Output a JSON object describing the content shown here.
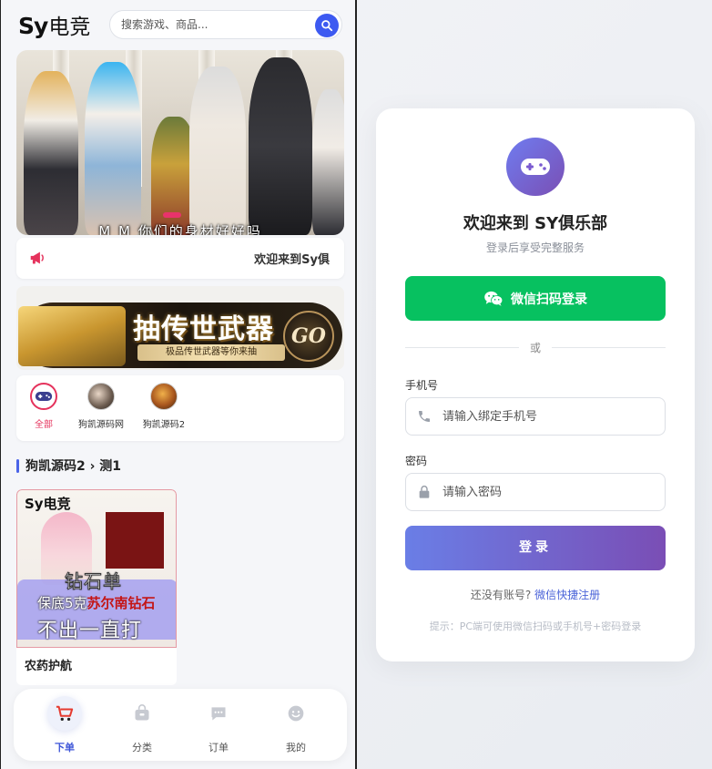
{
  "colors": {
    "accent_blue": "#3d5af1",
    "pink": "#e5325c",
    "wechat_green": "#07c160",
    "login_gradient_start": "#6a7ee6",
    "login_gradient_end": "#7a4eb5"
  },
  "phone": {
    "logo": {
      "sy": "Sy",
      "cn": "电竞"
    },
    "search": {
      "placeholder": "搜索游戏、商品..."
    },
    "banner": {
      "caption": "M M 你们的身材好好吗"
    },
    "notice": {
      "text": "欢迎来到Sy俱"
    },
    "promo": {
      "title": "抽传世武器",
      "subtitle": "极品传世武器等你来抽",
      "go": "GO"
    },
    "categories": [
      {
        "label": "全部",
        "icon": "gamepad-icon",
        "active": true
      },
      {
        "label": "狗凯源码网",
        "icon": "game-avatar"
      },
      {
        "label": "狗凯源码2",
        "icon": "game-avatar"
      }
    ],
    "section": {
      "title": "狗凯源码2 › 测1"
    },
    "product": {
      "brand": "Sy电竞",
      "line1": "钻石单",
      "line2_prefix": "保底5克",
      "line2_highlight": "苏尔南钻石",
      "line3": "不出一直打",
      "name": "农药护航"
    },
    "tabs": [
      {
        "label": "下单",
        "icon": "cart-icon",
        "active": true
      },
      {
        "label": "分类",
        "icon": "bag-icon"
      },
      {
        "label": "订单",
        "icon": "chat-icon"
      },
      {
        "label": "我的",
        "icon": "smile-icon"
      }
    ]
  },
  "login": {
    "welcome": "欢迎来到 SY俱乐部",
    "subtitle": "登录后享受完整服务",
    "wechat_button": "微信扫码登录",
    "divider": "或",
    "phone_label": "手机号",
    "phone_placeholder": "请输入绑定手机号",
    "password_label": "密码",
    "password_placeholder": "请输入密码",
    "login_button": "登录",
    "register_prompt": "还没有账号?",
    "register_link": "微信快捷注册",
    "hint": "提示：PC端可使用微信扫码或手机号+密码登录"
  }
}
